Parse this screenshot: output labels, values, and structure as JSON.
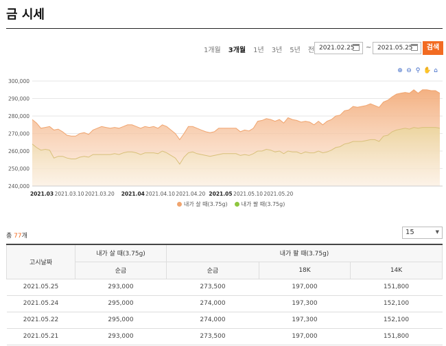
{
  "page_title": "금 시세",
  "period_tabs": [
    {
      "label": "1개월",
      "active": false
    },
    {
      "label": "3개월",
      "active": true
    },
    {
      "label": "1년",
      "active": false
    },
    {
      "label": "3년",
      "active": false
    },
    {
      "label": "5년",
      "active": false
    },
    {
      "label": "전체",
      "active": false
    }
  ],
  "date_from": "2021.02.25",
  "date_sep": "~",
  "date_to": "2021.05.25",
  "search_label": "검색",
  "chart_tools": [
    "zoom-in-icon",
    "zoom-out-icon",
    "magnify-icon",
    "pan-hand-icon",
    "home-icon"
  ],
  "chart_data": {
    "type": "area",
    "ylim": [
      240000,
      300000
    ],
    "yticks": [
      "240,000",
      "250,000",
      "260,000",
      "270,000",
      "280,000",
      "290,000",
      "300,000"
    ],
    "xticks": [
      {
        "label": "2021.03",
        "bold": true,
        "pos": 0.047
      },
      {
        "label": "2021.03.10",
        "bold": false,
        "pos": 0.181
      },
      {
        "label": "2021.03.20",
        "bold": false,
        "pos": 0.329
      },
      {
        "label": "2021.04",
        "bold": true,
        "pos": 0.491
      },
      {
        "label": "2021.04.10",
        "bold": false,
        "pos": 0.624
      },
      {
        "label": "2021.04.20",
        "bold": false,
        "pos": 0.772
      },
      {
        "label": "2021.05",
        "bold": true,
        "pos": 0.918
      },
      {
        "label": "2021.05.10",
        "bold": false,
        "pos": 1.052
      },
      {
        "label": "2021.05.20",
        "bold": false,
        "pos": 1.2
      }
    ],
    "series": [
      {
        "name": "내가 살 때(3.75g)",
        "color": "#f0a46e",
        "values": [
          278000,
          276000,
          273000,
          273500,
          274000,
          272000,
          272500,
          271000,
          269000,
          268500,
          268500,
          270000,
          270500,
          269500,
          272000,
          273000,
          274000,
          273500,
          273000,
          273500,
          273000,
          274000,
          275000,
          275000,
          274000,
          273000,
          274000,
          273500,
          274000,
          273000,
          275000,
          274000,
          272000,
          270000,
          266500,
          270000,
          274000,
          274000,
          273000,
          272000,
          271000,
          270500,
          271000,
          273000,
          273000,
          273000,
          273000,
          273000,
          271000,
          272000,
          271500,
          273000,
          277000,
          277500,
          278500,
          278000,
          277000,
          278000,
          276000,
          279000,
          278000,
          277500,
          276500,
          277000,
          276500,
          275000,
          277000,
          275000,
          277000,
          278000,
          280000,
          280500,
          283000,
          283500,
          285500,
          285000,
          285500,
          286000,
          287000,
          286000,
          285000,
          288000,
          289000,
          291000,
          292500,
          293000,
          293500,
          293000,
          295000,
          293000,
          295000,
          295000,
          294500,
          294500,
          293000
        ]
      },
      {
        "name": "내가 팔 때(3.75g)",
        "color": "#8ec63f",
        "values": [
          264000,
          262000,
          260500,
          261000,
          260500,
          256000,
          257000,
          257000,
          256000,
          255500,
          255500,
          256500,
          257000,
          256500,
          258000,
          258000,
          258000,
          258000,
          258000,
          258500,
          258000,
          259000,
          259500,
          259500,
          259000,
          258000,
          259000,
          259000,
          259000,
          258500,
          260000,
          259000,
          257500,
          256000,
          252500,
          256500,
          259000,
          259500,
          258500,
          258000,
          257500,
          257000,
          257500,
          258000,
          258500,
          258500,
          258500,
          258500,
          257500,
          258000,
          257500,
          258500,
          260000,
          260000,
          261000,
          260500,
          259500,
          260000,
          258500,
          260000,
          259500,
          259500,
          258500,
          259500,
          259000,
          259000,
          260000,
          259000,
          259500,
          260500,
          262000,
          262500,
          264000,
          264500,
          265500,
          265500,
          265500,
          266000,
          266500,
          266500,
          265500,
          268500,
          269000,
          271000,
          272000,
          272500,
          273000,
          272500,
          273500,
          273000,
          273500,
          273500,
          273500,
          273500,
          273000
        ]
      }
    ]
  },
  "legend": [
    "내가 살 때(3.75g)",
    "내가 팔 때(3.75g)"
  ],
  "total_prefix": "총 ",
  "total_count": "77",
  "total_suffix": "개",
  "page_size": "15",
  "table": {
    "head_date": "고시날짜",
    "head_buy": "내가 살 때(3.75g)",
    "head_sell": "내가 팔 때(3.75g)",
    "sub_buy_pure": "순금",
    "sub_sell_pure": "순금",
    "sub_18k": "18K",
    "sub_14k": "14K",
    "rows": [
      [
        "2021.05.25",
        "293,000",
        "273,500",
        "197,000",
        "151,800"
      ],
      [
        "2021.05.24",
        "295,000",
        "274,000",
        "197,300",
        "152,100"
      ],
      [
        "2021.05.22",
        "295,000",
        "274,000",
        "197,300",
        "152,100"
      ],
      [
        "2021.05.21",
        "293,000",
        "273,500",
        "197,000",
        "151,800"
      ]
    ]
  }
}
